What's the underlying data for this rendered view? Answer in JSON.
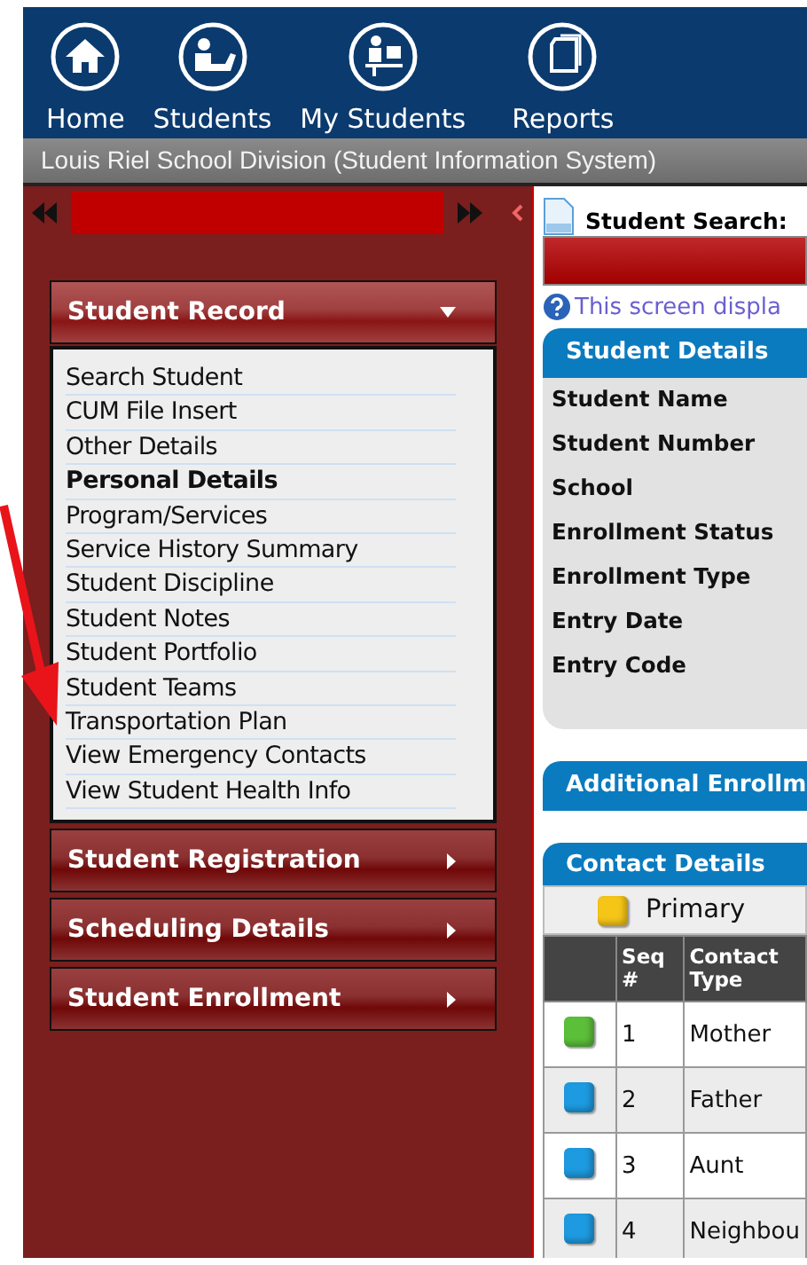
{
  "nav": [
    {
      "kind": "home",
      "label": "Home"
    },
    {
      "kind": "students",
      "label": "Students"
    },
    {
      "kind": "mystudents",
      "label": "My Students"
    },
    {
      "kind": "reports",
      "label": "Reports"
    }
  ],
  "subtitle": "Louis Riel School Division (Student Information System)",
  "sidebar": {
    "sections": [
      {
        "title": "Student Record",
        "expanded": true,
        "items": [
          {
            "label": "Search Student",
            "selected": false
          },
          {
            "label": "CUM File Insert",
            "selected": false
          },
          {
            "label": "Other Details",
            "selected": false
          },
          {
            "label": "Personal Details",
            "selected": true
          },
          {
            "label": "Program/Services",
            "selected": false
          },
          {
            "label": "Service History Summary",
            "selected": false
          },
          {
            "label": "Student Discipline",
            "selected": false
          },
          {
            "label": "Student Notes",
            "selected": false
          },
          {
            "label": "Student Portfolio",
            "selected": false
          },
          {
            "label": "Student Teams",
            "selected": false
          },
          {
            "label": "Transportation Plan",
            "selected": false
          },
          {
            "label": "View Emergency Contacts",
            "selected": false
          },
          {
            "label": "View Student Health Info",
            "selected": false
          }
        ]
      },
      {
        "title": "Student Registration",
        "expanded": false
      },
      {
        "title": "Scheduling Details",
        "expanded": false
      },
      {
        "title": "Student Enrollment",
        "expanded": false
      }
    ]
  },
  "main": {
    "title": "Student Search:",
    "help": "This screen displa",
    "student_details": {
      "title": "Student Details",
      "fields": [
        "Student Name",
        "Student Number",
        "School",
        "Enrollment Status",
        "Enrollment Type",
        "Entry Date",
        "Entry Code"
      ]
    },
    "additional": {
      "title": "Additional Enrollm"
    },
    "contacts": {
      "title": "Contact Details",
      "legend": {
        "label": "Primary",
        "color": "#f5c518"
      },
      "columns": [
        "Seq #",
        "Contact Type"
      ],
      "rows": [
        {
          "color": "#5cbf3a",
          "seq": "1",
          "type": "Mother"
        },
        {
          "color": "#1e9be0",
          "seq": "2",
          "type": "Father"
        },
        {
          "color": "#1e9be0",
          "seq": "3",
          "type": "Aunt"
        },
        {
          "color": "#1e9be0",
          "seq": "4",
          "type": "Neighbou"
        }
      ]
    }
  }
}
